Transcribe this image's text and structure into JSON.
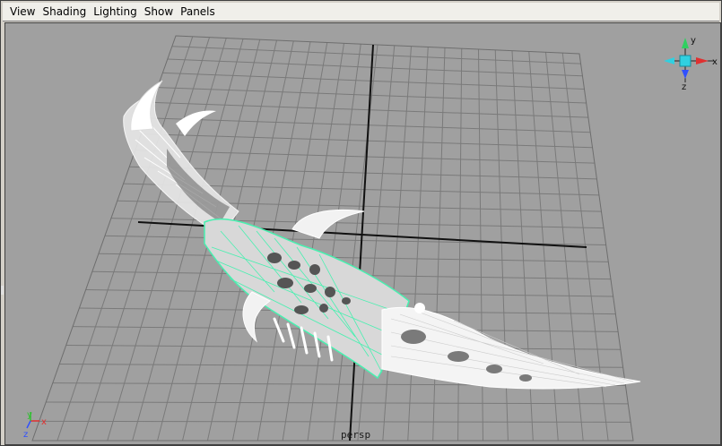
{
  "menubar": {
    "items": [
      "View",
      "Shading",
      "Lighting",
      "Show",
      "Panels"
    ]
  },
  "viewport": {
    "camera_label": "persp",
    "background_color": "#a0a0a0",
    "grid_color": "#7a7a7a",
    "axis_color": "#111111",
    "wireframe_color": "#ffffff",
    "selected_wire_color": "#48f0b0",
    "object": "curved dagger blade wireframe"
  },
  "view_cube": {
    "labels": [
      "y",
      "z",
      "x"
    ],
    "colors": {
      "x": "#e03030",
      "y": "#30d060",
      "z": "#3050ff",
      "cube": "#30d0e0"
    }
  },
  "origin_axis": {
    "labels": {
      "x": "x",
      "y": "y",
      "z": "z"
    },
    "colors": {
      "x": "#e03030",
      "y": "#30c030",
      "z": "#3050ff"
    }
  }
}
